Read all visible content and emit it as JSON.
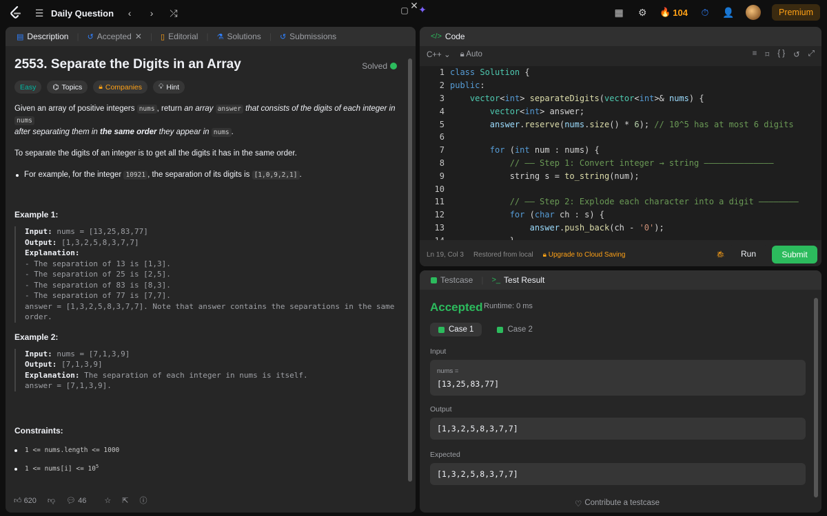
{
  "topbar": {
    "title": "Daily Question",
    "streak": "104",
    "premium": "Premium"
  },
  "left": {
    "tabs": [
      "Description",
      "Accepted",
      "Editorial",
      "Solutions",
      "Submissions"
    ],
    "title": "2553. Separate the Digits in an Array",
    "solved": "Solved",
    "tags": [
      "Easy",
      "Topics",
      "Companies",
      "Hint"
    ],
    "p1a": "Given an array of positive integers ",
    "p1b": "nums",
    "p1c": ", return ",
    "p1d": "an array ",
    "p1e": "answer",
    "p1f": " that consists of the digits of each integer in ",
    "p1g": "nums",
    "p1h": "after separating them in ",
    "p1i": "the same order",
    "p1j": " they appear in ",
    "p1k": "nums",
    "p1l": ".",
    "p2": "To separate the digits of an integer is to get all the digits it has in the same order.",
    "bullet_a": "For example, for the integer ",
    "bullet_b": "10921",
    "bullet_c": ", the separation of its digits is ",
    "bullet_d": "[1,0,9,2,1]",
    "bullet_e": ".",
    "ex1_title": "Example 1:",
    "ex1_input_label": "Input:",
    "ex1_input": " nums = [13,25,83,77]",
    "ex1_output_label": "Output:",
    "ex1_output": " [1,3,2,5,8,3,7,7]",
    "ex1_expl_label": "Explanation:",
    "ex1_lines": [
      "- The separation of 13 is [1,3].",
      "- The separation of 25 is [2,5].",
      "- The separation of 83 is [8,3].",
      "- The separation of 77 is [7,7].",
      "answer = [1,3,2,5,8,3,7,7]. Note that answer contains the separations in the same",
      "order."
    ],
    "ex2_title": "Example 2:",
    "ex2_input_label": "Input:",
    "ex2_input": " nums = [7,1,3,9]",
    "ex2_output_label": "Output:",
    "ex2_output": " [7,1,3,9]",
    "ex2_expl_label": "Explanation:",
    "ex2_expl": " The separation of each integer in nums is itself.",
    "ex2_answer": "answer = [7,1,3,9].",
    "constraints_title": "Constraints:",
    "c1": "1 <= nums.length <= 1000",
    "c2": "1 <= nums[i] <= 10",
    "c2sup": "5",
    "likes": "620",
    "comments": "46"
  },
  "code": {
    "tab": "Code",
    "lang": "C++",
    "auto": "Auto",
    "status_pos": "Ln 19, Col 3",
    "status_restore": "Restored from local",
    "upgrade": "Upgrade to Cloud Saving",
    "run": "Run",
    "submit": "Submit"
  },
  "result": {
    "tabs": [
      "Testcase",
      "Test Result"
    ],
    "status": "Accepted",
    "runtime": "Runtime: 0 ms",
    "cases": [
      "Case 1",
      "Case 2"
    ],
    "input_label": "Input",
    "param": "nums =",
    "input_value": "[13,25,83,77]",
    "output_label": "Output",
    "output_value": "[1,3,2,5,8,3,7,7]",
    "expected_label": "Expected",
    "expected_value": "[1,3,2,5,8,3,7,7]",
    "contribute": "Contribute a testcase"
  },
  "colors": {
    "accent": "#ffa116",
    "success": "#2cbb5d",
    "easy": "#00b8a3"
  }
}
